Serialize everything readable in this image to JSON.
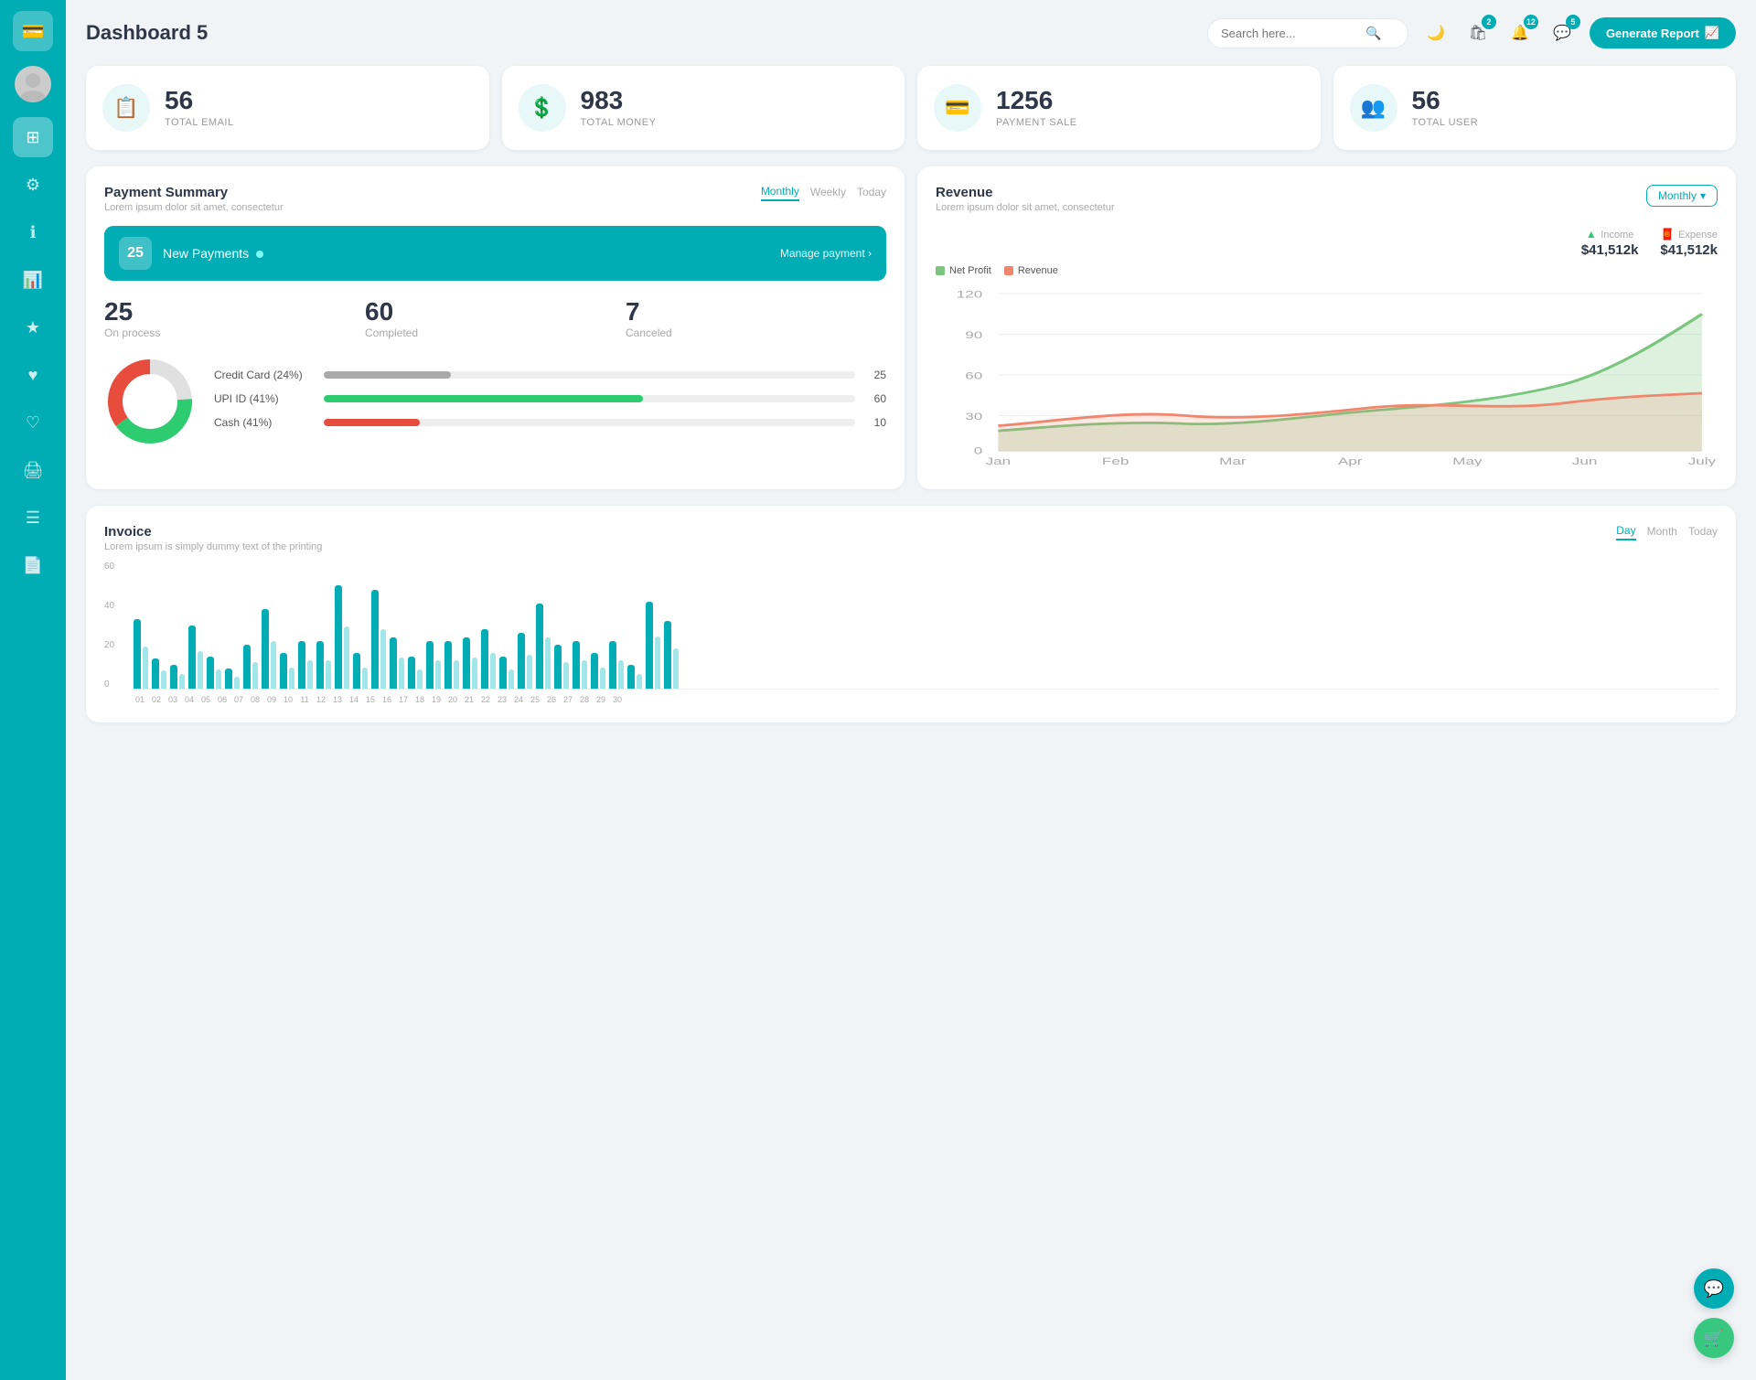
{
  "sidebar": {
    "logo_icon": "💳",
    "items": [
      {
        "id": "avatar",
        "icon": "👤",
        "active": false
      },
      {
        "id": "dashboard",
        "icon": "⊞",
        "active": true
      },
      {
        "id": "settings",
        "icon": "⚙",
        "active": false
      },
      {
        "id": "info",
        "icon": "ℹ",
        "active": false
      },
      {
        "id": "chart",
        "icon": "📊",
        "active": false
      },
      {
        "id": "star",
        "icon": "★",
        "active": false
      },
      {
        "id": "heart",
        "icon": "♥",
        "active": false
      },
      {
        "id": "heart2",
        "icon": "♡",
        "active": false
      },
      {
        "id": "print",
        "icon": "🖨",
        "active": false
      },
      {
        "id": "list",
        "icon": "☰",
        "active": false
      },
      {
        "id": "document",
        "icon": "📄",
        "active": false
      }
    ]
  },
  "header": {
    "title": "Dashboard 5",
    "search_placeholder": "Search here...",
    "badge_cart": "2",
    "badge_bell": "12",
    "badge_chat": "5",
    "generate_btn": "Generate Report"
  },
  "stats": [
    {
      "id": "total-email",
      "icon": "📋",
      "value": "56",
      "label": "TOTAL EMAIL"
    },
    {
      "id": "total-money",
      "icon": "💲",
      "value": "983",
      "label": "TOTAL MONEY"
    },
    {
      "id": "payment-sale",
      "icon": "💳",
      "value": "1256",
      "label": "PAYMENT SALE"
    },
    {
      "id": "total-user",
      "icon": "👥",
      "value": "56",
      "label": "TOTAL USER"
    }
  ],
  "payment_summary": {
    "title": "Payment Summary",
    "subtitle": "Lorem ipsum dolor sit amet, consectetur",
    "tabs": [
      "Monthly",
      "Weekly",
      "Today"
    ],
    "active_tab": "Monthly",
    "new_payments": {
      "count": "25",
      "label": "New Payments",
      "link": "Manage payment ›"
    },
    "metrics": [
      {
        "value": "25",
        "label": "On process"
      },
      {
        "value": "60",
        "label": "Completed"
      },
      {
        "value": "7",
        "label": "Canceled"
      }
    ],
    "payment_methods": [
      {
        "label": "Credit Card (24%)",
        "color": "#aaa",
        "pct": 24,
        "val": "25"
      },
      {
        "label": "UPI ID (41%)",
        "color": "#2ecc71",
        "pct": 60,
        "val": "60"
      },
      {
        "label": "Cash (41%)",
        "color": "#e74c3c",
        "pct": 18,
        "val": "10"
      }
    ],
    "donut": {
      "segments": [
        {
          "color": "#e0e0e0",
          "pct": 24
        },
        {
          "color": "#2ecc71",
          "pct": 41
        },
        {
          "color": "#e74c3c",
          "pct": 35
        }
      ]
    }
  },
  "revenue": {
    "title": "Revenue",
    "subtitle": "Lorem ipsum dolor sit amet, consectetur",
    "dropdown_label": "Monthly",
    "income_label": "Income",
    "income_value": "$41,512k",
    "expense_label": "Expense",
    "expense_value": "$41,512k",
    "legend": [
      {
        "label": "Net Profit",
        "color": "#7bc67e"
      },
      {
        "label": "Revenue",
        "color": "#f1866c"
      }
    ],
    "x_labels": [
      "Jan",
      "Feb",
      "Mar",
      "Apr",
      "May",
      "Jun",
      "July"
    ],
    "y_labels": [
      "0",
      "30",
      "60",
      "90",
      "120"
    ]
  },
  "invoice": {
    "title": "Invoice",
    "subtitle": "Lorem ipsum is simply dummy text of the printing",
    "tabs": [
      "Day",
      "Month",
      "Today"
    ],
    "active_tab": "Day",
    "y_labels": [
      "0",
      "20",
      "40",
      "60"
    ],
    "x_labels": [
      "01",
      "02",
      "03",
      "04",
      "05",
      "06",
      "07",
      "08",
      "09",
      "10",
      "11",
      "12",
      "13",
      "14",
      "15",
      "16",
      "17",
      "18",
      "19",
      "20",
      "21",
      "22",
      "23",
      "24",
      "25",
      "26",
      "27",
      "28",
      "29",
      "30"
    ],
    "bars": [
      35,
      15,
      12,
      32,
      16,
      10,
      22,
      40,
      18,
      24,
      24,
      52,
      18,
      50,
      26,
      16,
      24,
      24,
      26,
      30,
      16,
      28,
      43,
      22,
      24,
      18,
      24,
      12,
      44,
      34
    ]
  },
  "fabs": [
    {
      "icon": "💬",
      "color": "teal"
    },
    {
      "icon": "🛒",
      "color": "green"
    }
  ]
}
